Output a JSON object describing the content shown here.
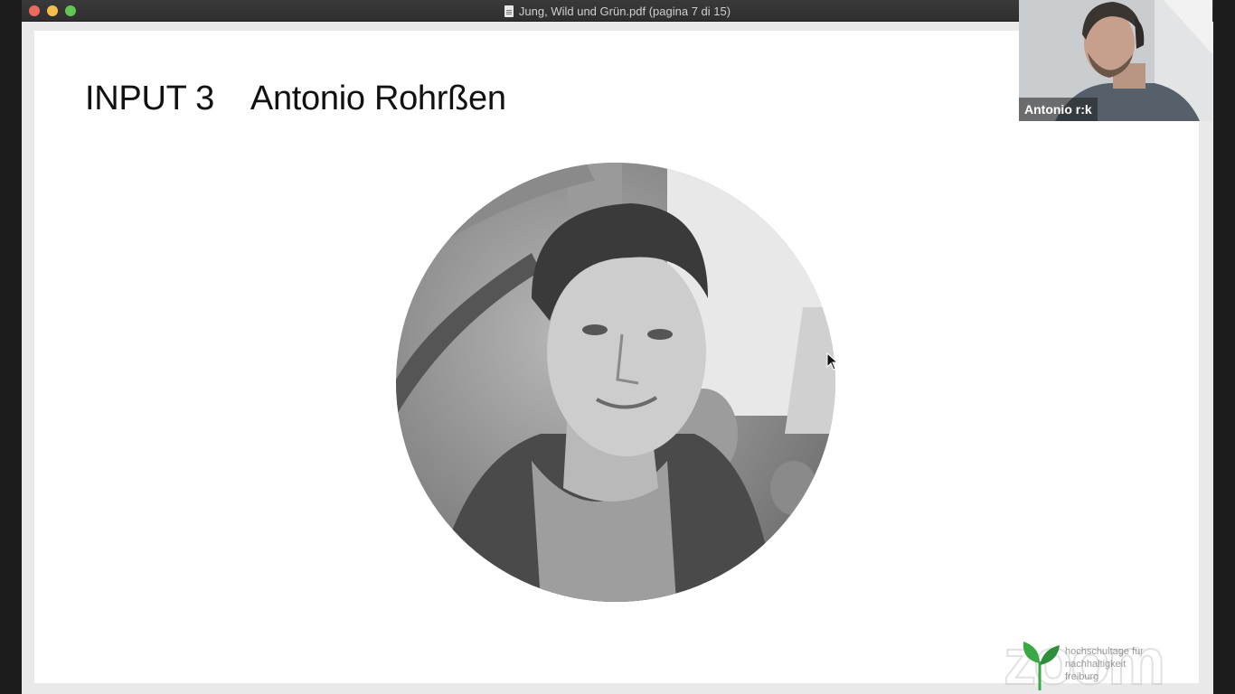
{
  "window": {
    "title": "Jung, Wild und Grün.pdf (pagina 7 di 15)"
  },
  "slide": {
    "input_label": "INPUT 3",
    "speaker_name": "Antonio Rohrßen"
  },
  "logo": {
    "watermark": "zoom",
    "lines": [
      "hochschultage für",
      "nachhaltigkeit",
      "freiburg"
    ]
  },
  "video": {
    "participant_name": "Antonio r:k"
  },
  "colors": {
    "close": "#ed6a5e",
    "minimize": "#f5bf4f",
    "maximize": "#62c554",
    "leaf_green": "#3aa845"
  },
  "icons": {
    "document": "pdf-document-icon",
    "cursor": "mouse-pointer-icon",
    "leaf": "leaf-icon"
  }
}
